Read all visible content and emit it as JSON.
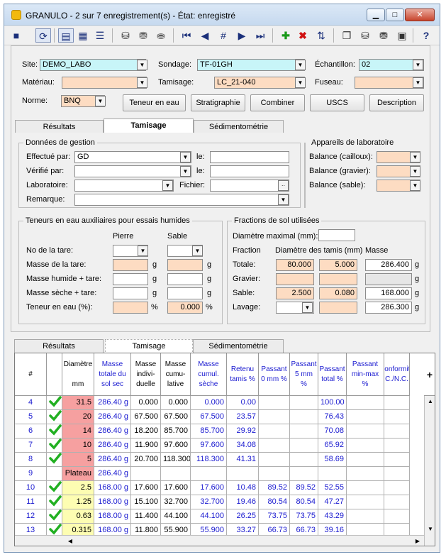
{
  "window": {
    "title": "GRANULO - 2 sur 7 enregistrement(s) - État: enregistré",
    "min": "▁",
    "max": "□",
    "close": "✕"
  },
  "toolbar": {
    "icons": [
      "save-icon",
      "refresh-icon",
      "form-view-icon",
      "table-view-icon",
      "list-view-icon",
      "db-icon",
      "db-copy-icon",
      "db-delete-icon",
      "first-record-icon",
      "prev-record-icon",
      "goto-record-icon",
      "next-record-icon",
      "last-record-icon",
      "add-record-icon",
      "delete-record-icon",
      "sort-icon",
      "archive-icon",
      "import-icon",
      "export-icon",
      "report-icon",
      "help-icon"
    ]
  },
  "form": {
    "site_label": "Site:",
    "site_value": "DEMO_LABO",
    "sondage_label": "Sondage:",
    "sondage_value": "TF-01GH",
    "echantillon_label": "Échantillon:",
    "echantillon_value": "02",
    "materiau_label": "Matériau:",
    "materiau_value": "",
    "tamisage_label": "Tamisage:",
    "tamisage_value": "LC_21-040",
    "fuseau_label": "Fuseau:",
    "fuseau_value": "",
    "norme_label": "Norme:",
    "norme_value": "BNQ",
    "buttons": [
      "Teneur en eau",
      "Stratigraphie",
      "Combiner",
      "USCS",
      "Description"
    ]
  },
  "tabs": [
    "Résultats",
    "Tamisage",
    "Sédimentométrie"
  ],
  "gestion": {
    "title": "Données de gestion",
    "effectue_label": "Effectué par:",
    "effectue_value": "GD",
    "verifie_label": "Vérifié par:",
    "verifie_value": "",
    "laboratoire_label": "Laboratoire:",
    "laboratoire_value": "",
    "remarque_label": "Remarque:",
    "remarque_value": "",
    "le_label": "le:",
    "fichier_label": "Fichier:"
  },
  "appareils": {
    "title": "Appareils de laboratoire",
    "cailloux": "Balance (cailloux):",
    "gravier": "Balance (gravier):",
    "sable": "Balance (sable):"
  },
  "teneurs": {
    "title": "Teneurs en eau auxiliaires pour essais humides",
    "pierre": "Pierre",
    "sable": "Sable",
    "rows": [
      "No de la tare:",
      "Masse de la tare:",
      "Masse humide + tare:",
      "Masse sèche + tare:",
      "Teneur en eau (%):"
    ],
    "units": [
      "",
      "g",
      "g",
      "g",
      "%"
    ],
    "sable_teneur": "0.000"
  },
  "fractions": {
    "title": "Fractions de sol utilisées",
    "diam_max_label": "Diamètre maximal (mm):",
    "fraction": "Fraction",
    "diametre": "Diamètre des tamis (mm)",
    "masse": "Masse",
    "rows": [
      {
        "label": "Totale:",
        "d1": "80.000",
        "d2": "5.000",
        "masse": "286.400",
        "unit": "g"
      },
      {
        "label": "Gravier:",
        "d1": "",
        "d2": "",
        "masse": "",
        "unit": "g"
      },
      {
        "label": "Sable:",
        "d1": "2.500",
        "d2": "0.080",
        "masse": "168.000",
        "unit": "g"
      },
      {
        "label": "Lavage:",
        "d1": "",
        "d2": "",
        "masse": "286.300",
        "unit": "g"
      }
    ]
  },
  "grid": {
    "headers": [
      "#",
      "",
      "Diamètre\n\nmm",
      "Masse totale du sol sec",
      "Masse indivi-duelle",
      "Masse cumu-lative",
      "Masse cumul. sèche",
      "Retenu tamis %",
      "Passant 0 mm %",
      "Passant 5 mm %",
      "Passant total %",
      "Passant min-max %",
      "Conformité C./N.C."
    ],
    "rows": [
      {
        "n": "4",
        "ok": true,
        "d": "31.5",
        "mt": "286.40 g",
        "mi": "0.000",
        "mc": "0.000",
        "ms": "0.000",
        "rt": "0.00",
        "p0": "",
        "p5": "",
        "pt": "100.00",
        "dcol": "pink"
      },
      {
        "n": "5",
        "ok": true,
        "d": "20",
        "mt": "286.40 g",
        "mi": "67.500",
        "mc": "67.500",
        "ms": "67.500",
        "rt": "23.57",
        "p0": "",
        "p5": "",
        "pt": "76.43",
        "dcol": "pink"
      },
      {
        "n": "6",
        "ok": true,
        "d": "14",
        "mt": "286.40 g",
        "mi": "18.200",
        "mc": "85.700",
        "ms": "85.700",
        "rt": "29.92",
        "p0": "",
        "p5": "",
        "pt": "70.08",
        "dcol": "pink"
      },
      {
        "n": "7",
        "ok": true,
        "d": "10",
        "mt": "286.40 g",
        "mi": "11.900",
        "mc": "97.600",
        "ms": "97.600",
        "rt": "34.08",
        "p0": "",
        "p5": "",
        "pt": "65.92",
        "dcol": "pink"
      },
      {
        "n": "8",
        "ok": true,
        "d": "5",
        "mt": "286.40 g",
        "mi": "20.700",
        "mc": "118.300",
        "ms": "118.300",
        "rt": "41.31",
        "p0": "",
        "p5": "",
        "pt": "58.69",
        "dcol": "pink"
      },
      {
        "n": "9",
        "ok": false,
        "d": "Plateau",
        "mt": "286.40 g",
        "mi": "",
        "mc": "",
        "ms": "",
        "rt": "",
        "p0": "",
        "p5": "",
        "pt": "",
        "dcol": "pink"
      },
      {
        "n": "10",
        "ok": true,
        "d": "2.5",
        "mt": "168.00 g",
        "mi": "17.600",
        "mc": "17.600",
        "ms": "17.600",
        "rt": "10.48",
        "p0": "89.52",
        "p5": "89.52",
        "pt": "52.55",
        "dcol": "yellow"
      },
      {
        "n": "11",
        "ok": true,
        "d": "1.25",
        "mt": "168.00 g",
        "mi": "15.100",
        "mc": "32.700",
        "ms": "32.700",
        "rt": "19.46",
        "p0": "80.54",
        "p5": "80.54",
        "pt": "47.27",
        "dcol": "yellow"
      },
      {
        "n": "12",
        "ok": true,
        "d": "0.63",
        "mt": "168.00 g",
        "mi": "11.400",
        "mc": "44.100",
        "ms": "44.100",
        "rt": "26.25",
        "p0": "73.75",
        "p5": "73.75",
        "pt": "43.29",
        "dcol": "yellow"
      },
      {
        "n": "13",
        "ok": true,
        "d": "0.315",
        "mt": "168.00 g",
        "mi": "11.800",
        "mc": "55.900",
        "ms": "55.900",
        "rt": "33.27",
        "p0": "66.73",
        "p5": "66.73",
        "pt": "39.16",
        "dcol": "yellow"
      }
    ]
  }
}
